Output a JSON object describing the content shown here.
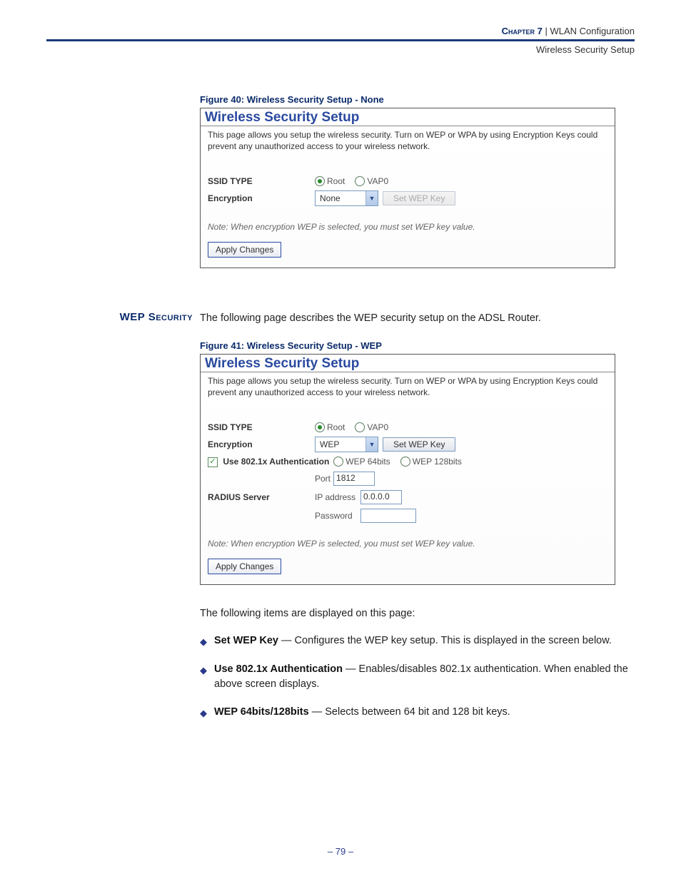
{
  "header": {
    "chapter": "Chapter 7",
    "sep": "  |  ",
    "section": "WLAN Configuration",
    "subsection": "Wireless Security Setup"
  },
  "fig40": {
    "caption": "Figure 40:  Wireless Security Setup - None",
    "title": "Wireless Security Setup",
    "desc": "This page allows you setup the wireless security. Turn on WEP or WPA by using Encryption Keys could prevent any unauthorized access to your wireless network.",
    "ssid_label": "SSID TYPE",
    "ssid_root": "Root",
    "ssid_vap0": "VAP0",
    "enc_label": "Encryption",
    "enc_value": "None",
    "setwep_btn": "Set WEP Key",
    "note": "Note: When encryption WEP is selected, you must set WEP key value.",
    "apply": "Apply Changes"
  },
  "wep_section": {
    "heading": "WEP Security",
    "text": "The following page describes the WEP security setup on the ADSL Router."
  },
  "fig41": {
    "caption": "Figure 41:  Wireless Security Setup - WEP",
    "title": "Wireless Security Setup",
    "desc": "This page allows you setup the wireless security. Turn on WEP or WPA by using Encryption Keys could prevent any unauthorized access to your wireless network.",
    "ssid_label": "SSID TYPE",
    "ssid_root": "Root",
    "ssid_vap0": "VAP0",
    "enc_label": "Encryption",
    "enc_value": "WEP",
    "setwep_btn": "Set WEP Key",
    "use8021x_label": "Use 802.1x Authentication",
    "wep64": "WEP 64bits",
    "wep128": "WEP 128bits",
    "port_label": "Port",
    "port_value": "1812",
    "radius_label": "RADIUS Server",
    "ip_label": "IP address",
    "ip_value": "0.0.0.0",
    "pw_label": "Password",
    "pw_value": "",
    "note": "Note: When encryption WEP is selected, you must set WEP key value.",
    "apply": "Apply Changes"
  },
  "body_intro": "The following items are displayed on this page:",
  "bullets": [
    {
      "term": "Set WEP Key",
      "desc": " — Configures the WEP key setup. This is displayed in the screen below."
    },
    {
      "term": "Use 802.1x Authentication",
      "desc": " — Enables/disables 802.1x authentication. When enabled the above screen displays."
    },
    {
      "term": "WEP 64bits/128bits",
      "desc": " — Selects between 64 bit and 128 bit keys."
    }
  ],
  "page_number": "–  79  –"
}
